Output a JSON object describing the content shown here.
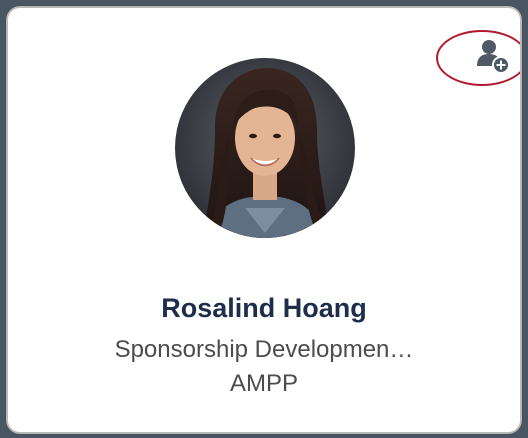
{
  "profile_card": {
    "name": "Rosalind Hoang",
    "job_title": "Sponsorship Developmen…",
    "organization": "AMPP"
  },
  "icons": {
    "follow": "add-person-icon",
    "avatar": "profile-photo"
  },
  "colors": {
    "name_text": "#1c2e4a",
    "subtitle_text": "#4c4c4c",
    "icon": "#4f5a66",
    "annotation_ring": "#b11a2c",
    "page_background": "#4a5662"
  }
}
